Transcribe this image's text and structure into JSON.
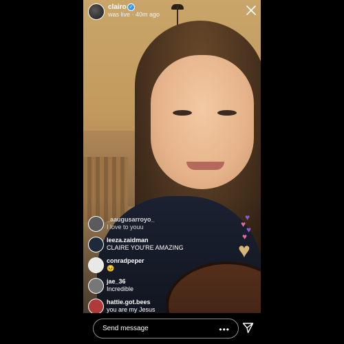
{
  "header": {
    "username": "clairo",
    "status": "was live · 40m ago",
    "verified_icon": "verified-badge-icon",
    "close_icon": "close-icon"
  },
  "comments": [
    {
      "user": "_aaugusarroyo_",
      "text": "I love to youu",
      "avatar_color": "#5b5b5b"
    },
    {
      "user": "leeza.zaidman",
      "text": "CLAIRE YOU'RE AMAZING",
      "avatar_color": "#1e2a3a"
    },
    {
      "user": "conradpeper",
      "text": "😣",
      "avatar_color": "#e8e8e8"
    },
    {
      "user": "jae_36",
      "text": "Incredible",
      "avatar_color": "#777777"
    },
    {
      "user": "hattie.got.bees",
      "text": "you are my Jesus",
      "avatar_color": "#b03a3a"
    }
  ],
  "composer": {
    "placeholder": "Send message",
    "more_icon": "more-dots-icon",
    "send_icon": "paper-plane-icon"
  },
  "colors": {
    "verified": "#3897f0",
    "heart_purple": "#8a5bd6",
    "heart_pink": "#e06a9a",
    "heart_gold": "#d7b777"
  }
}
